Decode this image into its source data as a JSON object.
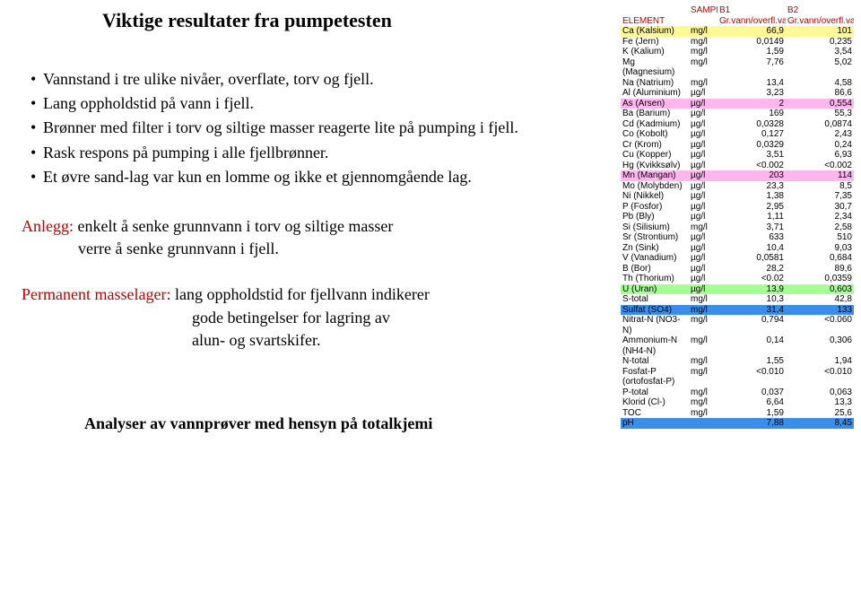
{
  "title": "Viktige resultater fra pumpetesten",
  "bullets": [
    "Vannstand i tre ulike nivåer, overflate, torv og fjell.",
    "Lang oppholdstid på vann i fjell.",
    "Brønner med filter i torv og siltige masser reagerte lite på pumping i fjell.",
    "Rask respons på pumping i alle fjellbrønner.",
    "Et øvre sand-lag var kun en lomme og ikke et gjennomgående lag."
  ],
  "section1": {
    "lead": "Anlegg:",
    "l1": "enkelt å senke grunnvann i torv og siltige masser",
    "l2": "verre å senke grunnvann i fjell."
  },
  "section2": {
    "lead": "Permanent masselager:",
    "l1": "lang oppholdstid for fjellvann indikerer",
    "l2": "gode betingelser for lagring av",
    "l3": "alun- og svartskifer."
  },
  "analysis_title": "Analyser av vannprøver med hensyn på totalkjemi",
  "table": {
    "header": {
      "c0": "ELEMENT",
      "c1": "SAMPLE",
      "c2a": "B1",
      "c2b": "Gr.vann/overfl.vann",
      "c3a": "B2",
      "c3b": "Gr.vann/overfl.vann"
    },
    "rows": [
      {
        "el": "Ca (Kalsium)",
        "u": "mg/l",
        "v1": "66,9",
        "v2": "101",
        "hl": "hl-yellow"
      },
      {
        "el": "Fe (Jern)",
        "u": "mg/l",
        "v1": "0,0149",
        "v2": "0,235"
      },
      {
        "el": "K (Kalium)",
        "u": "mg/l",
        "v1": "1,59",
        "v2": "3,54"
      },
      {
        "el": "Mg (Magnesium)",
        "u": "mg/l",
        "v1": "7,76",
        "v2": "5,02"
      },
      {
        "el": "Na (Natrium)",
        "u": "mg/l",
        "v1": "13,4",
        "v2": "4,58"
      },
      {
        "el": "Al (Aluminium)",
        "u": "µg/l",
        "v1": "3,23",
        "v2": "86,6"
      },
      {
        "el": "As (Arsen)",
        "u": "µg/l",
        "v1": "2",
        "v2": "0,554",
        "hl": "hl-pink"
      },
      {
        "el": "Ba (Barium)",
        "u": "µg/l",
        "v1": "169",
        "v2": "55,3"
      },
      {
        "el": "Cd (Kadmium)",
        "u": "µg/l",
        "v1": "0,0328",
        "v2": "0,0874"
      },
      {
        "el": "Co (Kobolt)",
        "u": "µg/l",
        "v1": "0,127",
        "v2": "2,43"
      },
      {
        "el": "Cr (Krom)",
        "u": "µg/l",
        "v1": "0,0329",
        "v2": "0,24"
      },
      {
        "el": "Cu (Kopper)",
        "u": "µg/l",
        "v1": "3,51",
        "v2": "6,93"
      },
      {
        "el": "Hg (Kvikksølv)",
        "u": "µg/l",
        "v1": "<0.002",
        "v2": "<0.002"
      },
      {
        "el": "Mn (Mangan)",
        "u": "µg/l",
        "v1": "203",
        "v2": "114",
        "hl": "hl-pink"
      },
      {
        "el": "Mo (Molybden)",
        "u": "µg/l",
        "v1": "23,3",
        "v2": "8,5"
      },
      {
        "el": "Ni (Nikkel)",
        "u": "µg/l",
        "v1": "1,38",
        "v2": "7,35"
      },
      {
        "el": "P (Fosfor)",
        "u": "µg/l",
        "v1": "2,95",
        "v2": "30,7"
      },
      {
        "el": "Pb (Bly)",
        "u": "µg/l",
        "v1": "1,11",
        "v2": "2,34"
      },
      {
        "el": "Si (Silisium)",
        "u": "mg/l",
        "v1": "3,71",
        "v2": "2,58"
      },
      {
        "el": "Sr (Strontium)",
        "u": "µg/l",
        "v1": "633",
        "v2": "510"
      },
      {
        "el": "Zn (Sink)",
        "u": "µg/l",
        "v1": "10,4",
        "v2": "9,03"
      },
      {
        "el": "V (Vanadium)",
        "u": "µg/l",
        "v1": "0,0581",
        "v2": "0,684"
      },
      {
        "el": "B (Bor)",
        "u": "µg/l",
        "v1": "28,2",
        "v2": "89,6"
      },
      {
        "el": "Th (Thorium)",
        "u": "µg/l",
        "v1": "<0.02",
        "v2": "0,0359"
      },
      {
        "el": "U (Uran)",
        "u": "µg/l",
        "v1": "13,9",
        "v2": "0,603",
        "hl": "hl-green"
      },
      {
        "el": "S-total",
        "u": "mg/l",
        "v1": "10,3",
        "v2": "42,8"
      },
      {
        "el": "Sulfat (SO4)",
        "u": "mg/l",
        "v1": "31,4",
        "v2": "133",
        "hl": "hl-blue"
      },
      {
        "el": "Nitrat-N (NO3-N)",
        "u": "mg/l",
        "v1": "0,794",
        "v2": "<0.060"
      },
      {
        "el": "Ammonium-N (NH4-N)",
        "u": "mg/l",
        "v1": "0,14",
        "v2": "0,306"
      },
      {
        "el": "N-total",
        "u": "mg/l",
        "v1": "1,55",
        "v2": "1,94"
      },
      {
        "el": "Fosfat-P (ortofosfat-P)",
        "u": "mg/l",
        "v1": "<0.010",
        "v2": "<0.010"
      },
      {
        "el": "P-total",
        "u": "mg/l",
        "v1": "0,037",
        "v2": "0,063"
      },
      {
        "el": "Klorid (Cl-)",
        "u": "mg/l",
        "v1": "6,64",
        "v2": "13,3"
      },
      {
        "el": "TOC",
        "u": "mg/l",
        "v1": "1,59",
        "v2": "25,6"
      },
      {
        "el": "pH",
        "u": "",
        "v1": "7,88",
        "v2": "8,45",
        "hl": "hl-blue"
      }
    ]
  }
}
